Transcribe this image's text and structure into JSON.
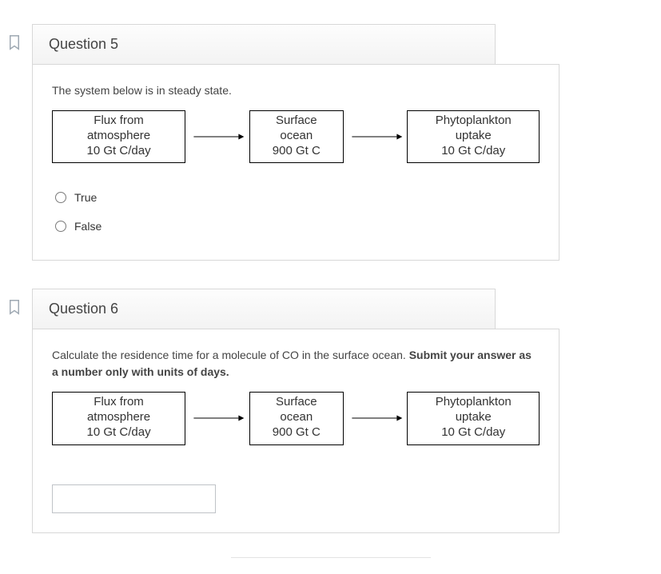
{
  "q5": {
    "title": "Question 5",
    "intro": "The system below is in steady state.",
    "boxes": {
      "a_title": "Flux from atmosphere",
      "a_sub": "10 Gt C/day",
      "b_title": "Surface ocean",
      "b_sub": "900 Gt C",
      "c_title": "Phytoplankton uptake",
      "c_sub": "10 Gt C/day"
    },
    "option_true": "True",
    "option_false": "False"
  },
  "q6": {
    "title": "Question 6",
    "intro_plain": "Calculate the residence time for a molecule of CO in the surface ocean. ",
    "intro_bold": "Submit your answer as a number only with units of days.",
    "boxes": {
      "a_title": "Flux from atmosphere",
      "a_sub": "10 Gt C/day",
      "b_title": "Surface ocean",
      "b_sub": "900 Gt C",
      "c_title": "Phytoplankton uptake",
      "c_sub": "10 Gt C/day"
    },
    "answer_placeholder": ""
  }
}
